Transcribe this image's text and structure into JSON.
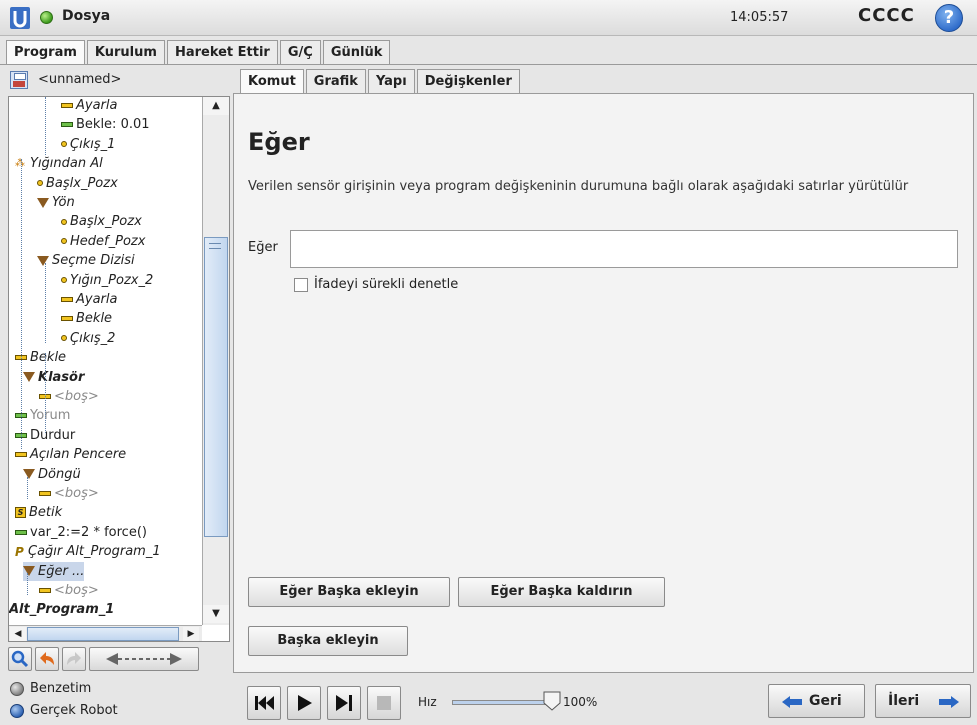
{
  "titlebar": {
    "app_title": "Dosya",
    "clock": "14:05:57",
    "robot_name": "CCCC",
    "help_label": "?",
    "status_color": "#3c9a1c"
  },
  "main_tabs": [
    "Program",
    "Kurulum",
    "Hareket Ettir",
    "G/Ç",
    "Günlük"
  ],
  "active_main_tab": "Program",
  "program_name": "<unnamed>",
  "tree": {
    "nodes": [
      {
        "label": "Ayarla",
        "icon": "set-icon",
        "italic": true
      },
      {
        "label": "Bekle: 0.01",
        "icon": "wait-icon"
      },
      {
        "label": "Çıkış_1",
        "icon": "waypoint-icon",
        "italic": true
      },
      {
        "label": "Yığından Al",
        "icon": "stack-icon",
        "italic": true
      },
      {
        "label": "Başlx_Pozx",
        "icon": "waypoint-icon",
        "italic": true
      },
      {
        "label": "Yön",
        "icon": "folder-icon",
        "italic": true
      },
      {
        "label": "Başlx_Pozx",
        "icon": "waypoint-icon",
        "italic": true
      },
      {
        "label": "Hedef_Pozx",
        "icon": "waypoint-icon",
        "italic": true
      },
      {
        "label": "Seçme Dizisi",
        "icon": "folder-icon",
        "italic": true
      },
      {
        "label": "Yığın_Pozx_2",
        "icon": "waypoint-icon",
        "italic": true
      },
      {
        "label": "Ayarla",
        "icon": "set-icon",
        "italic": true
      },
      {
        "label": "Bekle",
        "icon": "set-icon",
        "italic": true
      },
      {
        "label": "Çıkış_2",
        "icon": "waypoint-icon",
        "italic": true
      },
      {
        "label": "Bekle",
        "icon": "set-icon",
        "italic": true
      },
      {
        "label": "Klasör",
        "icon": "folder-icon",
        "italic": true,
        "bold": true
      },
      {
        "label": "<boş>",
        "icon": "set-icon",
        "italic": true,
        "grey": true
      },
      {
        "label": "Yorum",
        "icon": "wait-icon",
        "grey": true
      },
      {
        "label": "Durdur",
        "icon": "wait-icon"
      },
      {
        "label": "Açılan Pencere",
        "icon": "set-icon",
        "italic": true
      },
      {
        "label": "Döngü",
        "icon": "folder-icon",
        "italic": true
      },
      {
        "label": "<boş>",
        "icon": "set-icon",
        "italic": true,
        "grey": true
      },
      {
        "label": "Betik",
        "icon": "script-icon",
        "italic": true
      },
      {
        "label": "var_2:=2 * force()",
        "icon": "wait-icon"
      },
      {
        "label": "Çağır Alt_Program_1",
        "icon": "call-icon",
        "italic": true
      },
      {
        "label": "Eğer ...",
        "icon": "folder-icon",
        "italic": true,
        "selected": true
      },
      {
        "label": "<boş>",
        "icon": "set-icon",
        "italic": true,
        "grey": true
      },
      {
        "label": "Alt_Program_1",
        "icon": "none",
        "italic": true,
        "bold": true
      }
    ]
  },
  "sub_tabs": [
    "Komut",
    "Grafik",
    "Yapı",
    "Değişkenler"
  ],
  "active_sub_tab": "Komut",
  "command": {
    "title": "Eğer",
    "description": "Verilen sensör girişinin veya program değişkeninin durumuna bağlı olarak aşağıdaki satırlar yürütülür",
    "expr_label": "Eğer",
    "expr_value": "",
    "check_label": "İfadeyi sürekli denetle",
    "check_checked": false,
    "add_elseif": "Eğer Başka ekleyin",
    "remove_elseif": "Eğer Başka kaldırın",
    "add_else": "Başka ekleyin"
  },
  "footer": {
    "mode_sim": "Benzetim",
    "mode_real": "Gerçek Robot",
    "speed_label": "Hız",
    "speed_value": "100%",
    "speed_fraction": 1.0,
    "back_label": "Geri",
    "next_label": "İleri"
  }
}
